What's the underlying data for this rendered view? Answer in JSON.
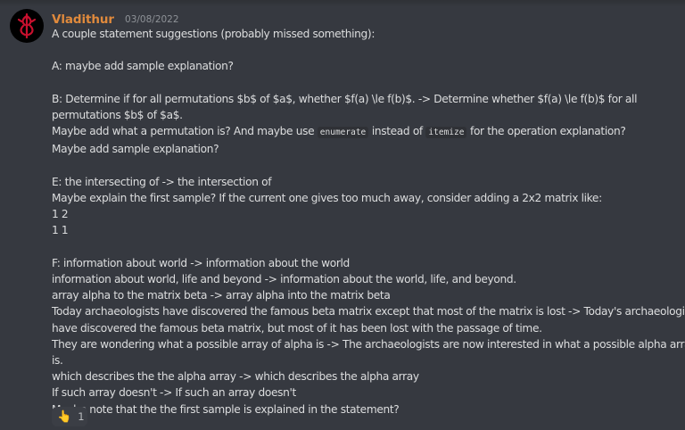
{
  "message": {
    "username": "Vladithur",
    "timestamp": "03/08/2022",
    "avatar_icon": "berserk-brand-icon",
    "accent_color": "#e08a3c",
    "lines": [
      "A couple statement suggestions (probably missed something):",
      "",
      "A: maybe add sample explanation?",
      "",
      "B: Determine if for all permutations $b$ of $a$, whether $f(a) \\le f(b)$. -> Determine whether $f(a) \\le f(b)$ for all",
      "permutations $b$ of $a$.",
      "Maybe add what a permutation is? And maybe use",
      "Maybe add sample explanation?",
      "",
      "E: the intersecting of -> the intersection of",
      "Maybe explain the first sample? If the current one gives too much away, consider adding a 2x2 matrix like:",
      "1 2",
      "1 1",
      "",
      "F: information about world -> information about the world",
      "information about world, life and beyond -> information about the world, life, and beyond.",
      "array alpha to the matrix beta -> array alpha into the matrix beta",
      "Today archaeologists have discovered the famous beta matrix except that most of the matrix is lost -> Today's archaeologists",
      "have discovered the famous beta matrix, but most of it has been lost with the passage of time.",
      "They are wondering what a possible array of alpha is -> The archaeologists are now interested in what a possible alpha array",
      "is.",
      "which describes the the alpha array -> which describes the alpha array",
      "If such array doesn't -> If such an array doesn't",
      "Maybe note that the the first sample is explained in the statement?"
    ],
    "inline_code": {
      "code1": "enumerate",
      "text_between": "instead of",
      "code2": "itemize",
      "text_after": "for the operation explanation?"
    },
    "reaction": {
      "emoji": "👆",
      "icon": "pointing-up-hand-icon",
      "count": "1"
    }
  }
}
